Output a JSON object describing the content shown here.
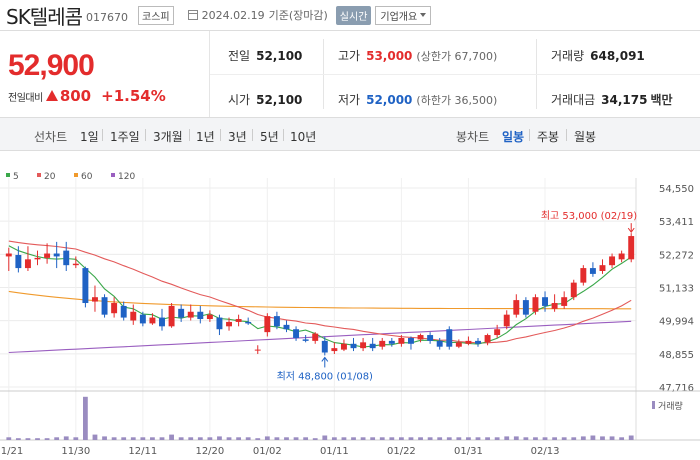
{
  "header": {
    "name": "SK텔레콤",
    "code": "017670",
    "market": "코스피",
    "date": "2024.02.19",
    "basis": "기준(장마감)",
    "realtime": "실시간",
    "company_info": "기업개요"
  },
  "price": {
    "current": "52,900",
    "change_label": "전일대비",
    "change": "800",
    "change_pct": "+1.54%"
  },
  "stats": {
    "prev_label": "전일",
    "prev": "52,100",
    "open_label": "시가",
    "open": "52,100",
    "high_label": "고가",
    "high": "53,000",
    "upper_limit": "(상한가 67,700)",
    "low_label": "저가",
    "low": "52,000",
    "lower_limit": "(하한가 36,500)",
    "volume_label": "거래량",
    "volume": "648,091",
    "amount_label": "거래대금",
    "amount": "34,175",
    "amount_unit": "백만"
  },
  "toolbar": {
    "line_label": "선차트",
    "periods": [
      "1일",
      "1주일",
      "3개월",
      "1년",
      "3년",
      "5년",
      "10년"
    ],
    "candle_label": "봉차트",
    "candle_types": [
      "일봉",
      "주봉",
      "월봉"
    ],
    "active_candle": "일봉"
  },
  "colors": {
    "up": "#e32c2c",
    "down": "#1f62c4",
    "ma5": "#3aa84a",
    "ma20": "#e35a5a",
    "ma60": "#f09a2c",
    "ma120": "#9a5fc0"
  },
  "chart_data": {
    "type": "candlestick",
    "legend": [
      {
        "name": "5",
        "color": "#3aa84a"
      },
      {
        "name": "20",
        "color": "#e35a5a"
      },
      {
        "name": "60",
        "color": "#f09a2c"
      },
      {
        "name": "120",
        "color": "#9a5fc0"
      }
    ],
    "y_ticks": [
      "54,550",
      "53,411",
      "52,272",
      "51,133",
      "49,994",
      "48,855",
      "47,716"
    ],
    "ylim": [
      47716,
      54550
    ],
    "x_labels": [
      "11/21",
      "11/30",
      "12/11",
      "12/20",
      "01/02",
      "01/11",
      "01/22",
      "01/31",
      "02/13"
    ],
    "x_label_index": [
      0,
      7,
      14,
      21,
      27,
      34,
      41,
      48,
      56
    ],
    "high_note": "최고 53,000 (02/19)",
    "low_note": "최저 48,800 (01/08)",
    "volume_label": "거래량",
    "candles": [
      {
        "o": 52200,
        "c": 52300,
        "h": 52500,
        "l": 51700
      },
      {
        "o": 52250,
        "c": 51800,
        "h": 52550,
        "l": 51650
      },
      {
        "o": 51800,
        "c": 52100,
        "h": 52550,
        "l": 51700
      },
      {
        "o": 52100,
        "c": 52150,
        "h": 52400,
        "l": 51900
      },
      {
        "o": 52150,
        "c": 52300,
        "h": 52650,
        "l": 51950
      },
      {
        "o": 52300,
        "c": 52200,
        "h": 52700,
        "l": 51800
      },
      {
        "o": 52400,
        "c": 51900,
        "h": 52700,
        "l": 51700
      },
      {
        "o": 51900,
        "c": 51950,
        "h": 52200,
        "l": 51800
      },
      {
        "o": 51800,
        "c": 50600,
        "h": 51850,
        "l": 50450
      },
      {
        "o": 50650,
        "c": 50800,
        "h": 51200,
        "l": 50300
      },
      {
        "o": 50800,
        "c": 50200,
        "h": 50900,
        "l": 50100
      },
      {
        "o": 50250,
        "c": 50600,
        "h": 50800,
        "l": 50100
      },
      {
        "o": 50500,
        "c": 50100,
        "h": 50650,
        "l": 50000
      },
      {
        "o": 50000,
        "c": 50300,
        "h": 50550,
        "l": 49850
      },
      {
        "o": 50200,
        "c": 49900,
        "h": 50300,
        "l": 49800
      },
      {
        "o": 49900,
        "c": 50100,
        "h": 50250,
        "l": 49850
      },
      {
        "o": 50100,
        "c": 49800,
        "h": 50400,
        "l": 49650
      },
      {
        "o": 49800,
        "c": 50500,
        "h": 50600,
        "l": 49750
      },
      {
        "o": 50400,
        "c": 50100,
        "h": 50550,
        "l": 49950
      },
      {
        "o": 50100,
        "c": 50300,
        "h": 50550,
        "l": 50000
      },
      {
        "o": 50300,
        "c": 50050,
        "h": 50500,
        "l": 49900
      },
      {
        "o": 50050,
        "c": 50200,
        "h": 50350,
        "l": 49950
      },
      {
        "o": 50100,
        "c": 49700,
        "h": 50200,
        "l": 49500
      },
      {
        "o": 49800,
        "c": 49950,
        "h": 50100,
        "l": 49650
      },
      {
        "o": 49950,
        "c": 50050,
        "h": 50200,
        "l": 49800
      },
      {
        "o": 49950,
        "c": 49900,
        "h": 50100,
        "l": 49850
      },
      {
        "o": 49000,
        "c": 49000,
        "h": 49150,
        "l": 48850
      },
      {
        "o": 49600,
        "c": 50150,
        "h": 50250,
        "l": 49450
      },
      {
        "o": 50150,
        "c": 49800,
        "h": 50300,
        "l": 49700
      },
      {
        "o": 49850,
        "c": 49700,
        "h": 50000,
        "l": 49600
      },
      {
        "o": 49700,
        "c": 49400,
        "h": 49800,
        "l": 49300
      },
      {
        "o": 49350,
        "c": 49300,
        "h": 49500,
        "l": 49250
      },
      {
        "o": 49300,
        "c": 49550,
        "h": 49600,
        "l": 49200
      },
      {
        "o": 49300,
        "c": 48900,
        "h": 49450,
        "l": 48800
      },
      {
        "o": 48950,
        "c": 49050,
        "h": 49250,
        "l": 48850
      },
      {
        "o": 49000,
        "c": 49200,
        "h": 49350,
        "l": 48950
      },
      {
        "o": 49200,
        "c": 49050,
        "h": 49400,
        "l": 48950
      },
      {
        "o": 49050,
        "c": 49250,
        "h": 49400,
        "l": 48950
      },
      {
        "o": 49200,
        "c": 49050,
        "h": 49400,
        "l": 48950
      },
      {
        "o": 49100,
        "c": 49300,
        "h": 49400,
        "l": 49000
      },
      {
        "o": 49300,
        "c": 49200,
        "h": 49400,
        "l": 49100
      },
      {
        "o": 49200,
        "c": 49400,
        "h": 49500,
        "l": 49100
      },
      {
        "o": 49400,
        "c": 49200,
        "h": 49450,
        "l": 49000
      },
      {
        "o": 49350,
        "c": 49500,
        "h": 49550,
        "l": 49250
      },
      {
        "o": 49500,
        "c": 49300,
        "h": 49600,
        "l": 49200
      },
      {
        "o": 49300,
        "c": 49100,
        "h": 49400,
        "l": 49000
      },
      {
        "o": 49700,
        "c": 49100,
        "h": 49800,
        "l": 49000
      },
      {
        "o": 49100,
        "c": 49250,
        "h": 49350,
        "l": 49050
      },
      {
        "o": 49200,
        "c": 49300,
        "h": 49450,
        "l": 49150
      },
      {
        "o": 49300,
        "c": 49200,
        "h": 49400,
        "l": 49100
      },
      {
        "o": 49250,
        "c": 49500,
        "h": 49550,
        "l": 49150
      },
      {
        "o": 49500,
        "c": 49700,
        "h": 49850,
        "l": 49400
      },
      {
        "o": 49800,
        "c": 50200,
        "h": 50350,
        "l": 49700
      },
      {
        "o": 50200,
        "c": 50700,
        "h": 50900,
        "l": 50100
      },
      {
        "o": 50700,
        "c": 50200,
        "h": 50800,
        "l": 50100
      },
      {
        "o": 50300,
        "c": 50800,
        "h": 50900,
        "l": 50200
      },
      {
        "o": 50800,
        "c": 50500,
        "h": 51000,
        "l": 50300
      },
      {
        "o": 50400,
        "c": 50600,
        "h": 50900,
        "l": 50300
      },
      {
        "o": 50500,
        "c": 50800,
        "h": 51000,
        "l": 50400
      },
      {
        "o": 50800,
        "c": 51300,
        "h": 51400,
        "l": 50700
      },
      {
        "o": 51300,
        "c": 51800,
        "h": 51900,
        "l": 51200
      },
      {
        "o": 51800,
        "c": 51600,
        "h": 52000,
        "l": 51500
      },
      {
        "o": 51700,
        "c": 51900,
        "h": 52100,
        "l": 51600
      },
      {
        "o": 51900,
        "c": 52200,
        "h": 52300,
        "l": 51800
      },
      {
        "o": 52100,
        "c": 52300,
        "h": 52400,
        "l": 52000
      },
      {
        "o": 52100,
        "c": 52900,
        "h": 53000,
        "l": 52000
      }
    ],
    "volumes": [
      3,
      2,
      2,
      2,
      2,
      3,
      4,
      3,
      48,
      6,
      4,
      3,
      3,
      3,
      3,
      3,
      3,
      6,
      3,
      3,
      3,
      3,
      4,
      3,
      3,
      3,
      2,
      4,
      3,
      3,
      3,
      3,
      2,
      5,
      3,
      3,
      3,
      3,
      3,
      3,
      3,
      3,
      3,
      3,
      3,
      3,
      3,
      3,
      3,
      3,
      3,
      3,
      4,
      4,
      3,
      3,
      3,
      3,
      3,
      3,
      4,
      5,
      4,
      4,
      3,
      5
    ],
    "vol_max": 50
  }
}
